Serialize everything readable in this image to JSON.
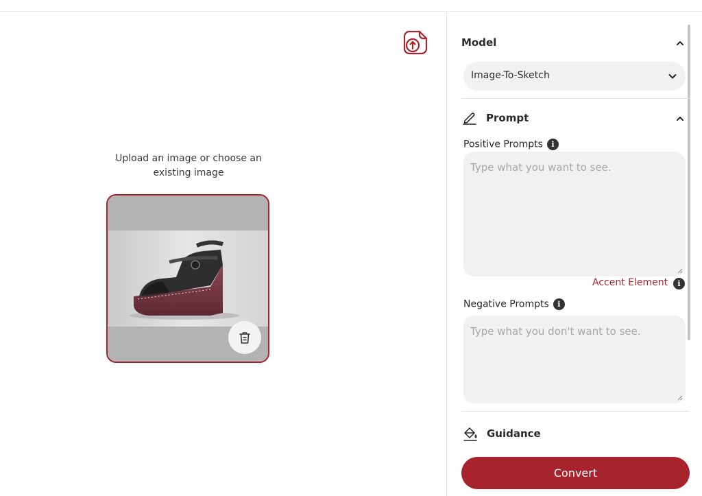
{
  "canvas": {
    "upload_hint": "Upload an image or choose an existing image"
  },
  "panel": {
    "model": {
      "title": "Model",
      "selected": "Image-To-Sketch"
    },
    "prompt": {
      "title": "Prompt",
      "positive_label": "Positive Prompts",
      "positive_placeholder": "Type what you want to see.",
      "accent_link": "Accent Element",
      "negative_label": "Negative Prompts",
      "negative_placeholder": "Type what you don't want to see."
    },
    "guidance": {
      "title": "Guidance"
    },
    "convert_label": "Convert"
  },
  "icons": {
    "upload": "upload-sticker-icon",
    "delete": "trash-icon",
    "prompt": "pencil-icon",
    "guidance": "paint-bucket-icon",
    "info": "info-icon"
  },
  "colors": {
    "accent": "#a8242d",
    "field_bg": "#f3f0f0"
  }
}
